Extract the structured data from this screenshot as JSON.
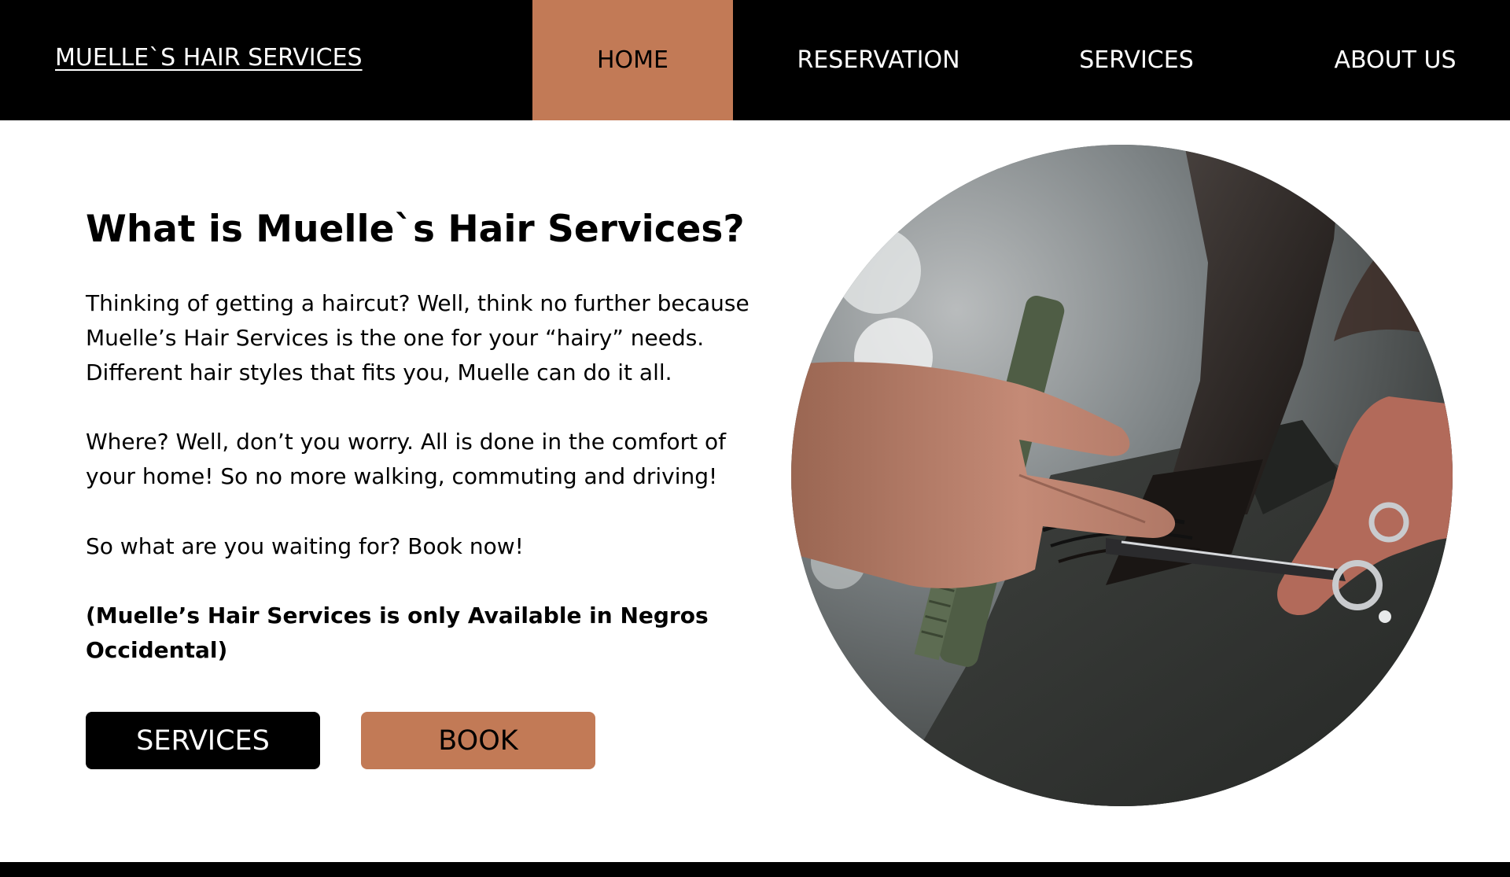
{
  "nav": {
    "brand": "MUELLE`S HAIR SERVICES",
    "items": [
      {
        "label": "HOME",
        "active": true
      },
      {
        "label": "RESERVATION",
        "active": false
      },
      {
        "label": "SERVICES",
        "active": false
      },
      {
        "label": "ABOUT US",
        "active": false
      }
    ]
  },
  "hero": {
    "title": "What is Muelle`s Hair Services?",
    "paragraphs": [
      "Thinking of getting a haircut? Well, think no further because Muelle’s Hair Services is the one for your “hairy” needs. Different hair styles that fits you, Muelle can do it all.",
      "Where? Well, don’t you worry. All is done in the comfort of your home! So no more walking, commuting and driving!",
      "So what are you waiting for? Book now!"
    ],
    "availability": "(Muelle’s Hair Services is only Available in Negros Occidental)",
    "buttons": {
      "services": "SERVICES",
      "book": "BOOK"
    },
    "photo_icon": "haircut-photo"
  },
  "colors": {
    "accent": "#c27a56",
    "navbar": "#000000",
    "background": "#ffffff"
  }
}
